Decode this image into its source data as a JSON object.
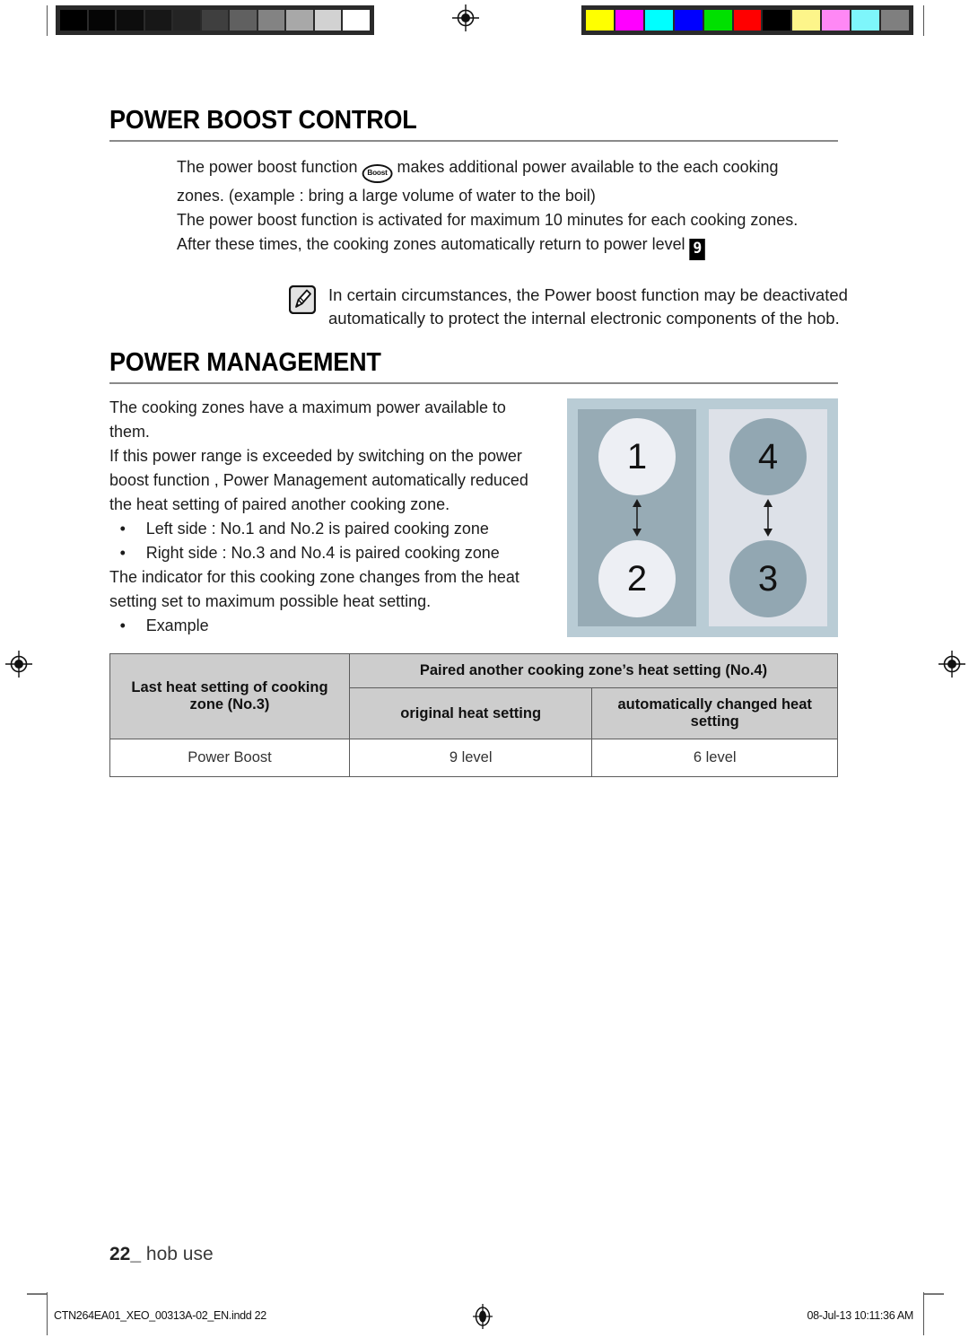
{
  "calibration": {
    "grayscale_label": "grayscale-calibration-bar",
    "grayscale_swatches": [
      "#000000",
      "#050505",
      "#0d0d0d",
      "#171717",
      "#242424",
      "#3f3f3f",
      "#606060",
      "#838383",
      "#a8a8a8",
      "#d2d2d2",
      "#ffffff"
    ],
    "color_label": "color-calibration-bar",
    "color_swatches": [
      "#ffff00",
      "#ff00ff",
      "#00ffff",
      "#0000ff",
      "#00e000",
      "#ff0000",
      "#000000",
      "#fdf58a",
      "#ff88f5",
      "#7ef6fb",
      "#7f7f7f"
    ]
  },
  "sections": {
    "power_boost": {
      "title": "POWER BOOST CONTROL",
      "paragraphs": [
        {
          "before": "The power boost function ",
          "icon": "Boost",
          "after": " makes additional power available to the each cooking zones. (example : bring a large volume of water to the boil)"
        },
        {
          "text": "The power boost function is activated for maximum 10 minutes for each cooking zones."
        },
        {
          "before": "After these times, the cooking zones automatically return to power level ",
          "level_icon": "9",
          "after": ""
        }
      ],
      "note": {
        "icon": "note-pencil-icon",
        "text": "In certain circumstances, the Power boost function may be deactivated automatically to protect the internal electronic components of the hob."
      }
    },
    "power_management": {
      "title": "POWER MANAGEMENT",
      "paragraphs": [
        "The cooking zones have a maximum power available to them.",
        "If this power range is exceeded by switching on the power boost function , Power Management automatically reduced the heat setting of paired another cooking zone."
      ],
      "bullets_1": [
        "Left side : No.1 and No.2 is paired cooking zone",
        "Right side : No.3 and No.4 is paired cooking zone"
      ],
      "paragraph_after": "The indicator for this cooking zone changes from the heat setting set to maximum possible heat setting.",
      "bullets_2": [
        "Example"
      ],
      "diagram": {
        "name": "hob-cooking-zone-diagram",
        "background_color": "#b9ccd5",
        "left_panel": {
          "color": "#97abb5",
          "burner_color": "#edeff4",
          "top_zone": "1",
          "bottom_zone": "2"
        },
        "right_panel": {
          "color": "#dde1e8",
          "burner_color": "#92a7b2",
          "top_zone": "4",
          "bottom_zone": "3"
        }
      },
      "table": {
        "header_col_a": "Last heat setting of cooking zone (No.3)",
        "header_group_b": "Paired another cooking zone’s heat setting (No.4)",
        "header_col_b": "original heat setting",
        "header_col_c": "automatically changed heat setting",
        "rows": [
          {
            "a": "Power Boost",
            "b": "9 level",
            "c": "6 level"
          }
        ]
      }
    }
  },
  "footer": {
    "page_number": "22",
    "separator": "_",
    "chapter": "hob use"
  },
  "imprint": {
    "file": "CTN264EA01_XEO_00313A-02_EN.indd   22",
    "timestamp": "08-Jul-13   10:11:36 AM"
  }
}
